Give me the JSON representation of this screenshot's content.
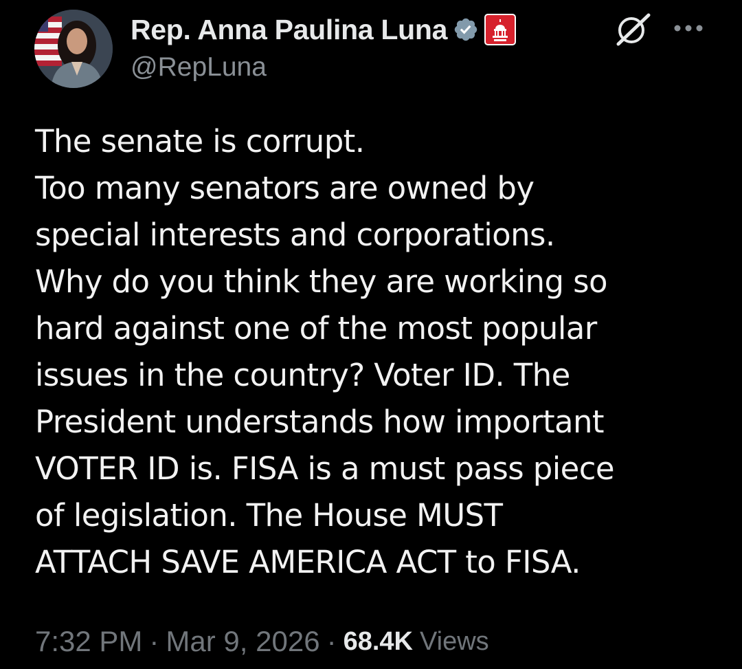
{
  "author": {
    "display_name": "Rep. Anna Paulina Luna",
    "handle": "@RepLuna",
    "avatar_icon": "profile-photo",
    "verified_icon": "verified-badge-icon",
    "affiliate_icon": "house-gop-affiliate-icon"
  },
  "actions": {
    "grok_icon": "grok-icon",
    "more_icon": "more-options-icon"
  },
  "tweet": {
    "lines": [
      "The senate is corrupt.",
      "Too many senators are owned by",
      "special interests and corporations.",
      "Why do you think they are working so",
      "hard against one of the most popular",
      "issues in the country? Voter ID. The",
      "President understands how important",
      "VOTER ID is. FISA is a must pass piece",
      "of legislation. The House MUST",
      "ATTACH SAVE AMERICA ACT to FISA."
    ]
  },
  "meta": {
    "time": "7:32 PM",
    "separator": "·",
    "date": "Mar 9, 2026",
    "views_count": "68.4K",
    "views_label": "Views"
  },
  "colors": {
    "background": "#000000",
    "primary_text": "#e7e9ea",
    "secondary_text": "#71767b",
    "verified_badge": "#829aab",
    "affiliate_red": "#d6212c"
  }
}
